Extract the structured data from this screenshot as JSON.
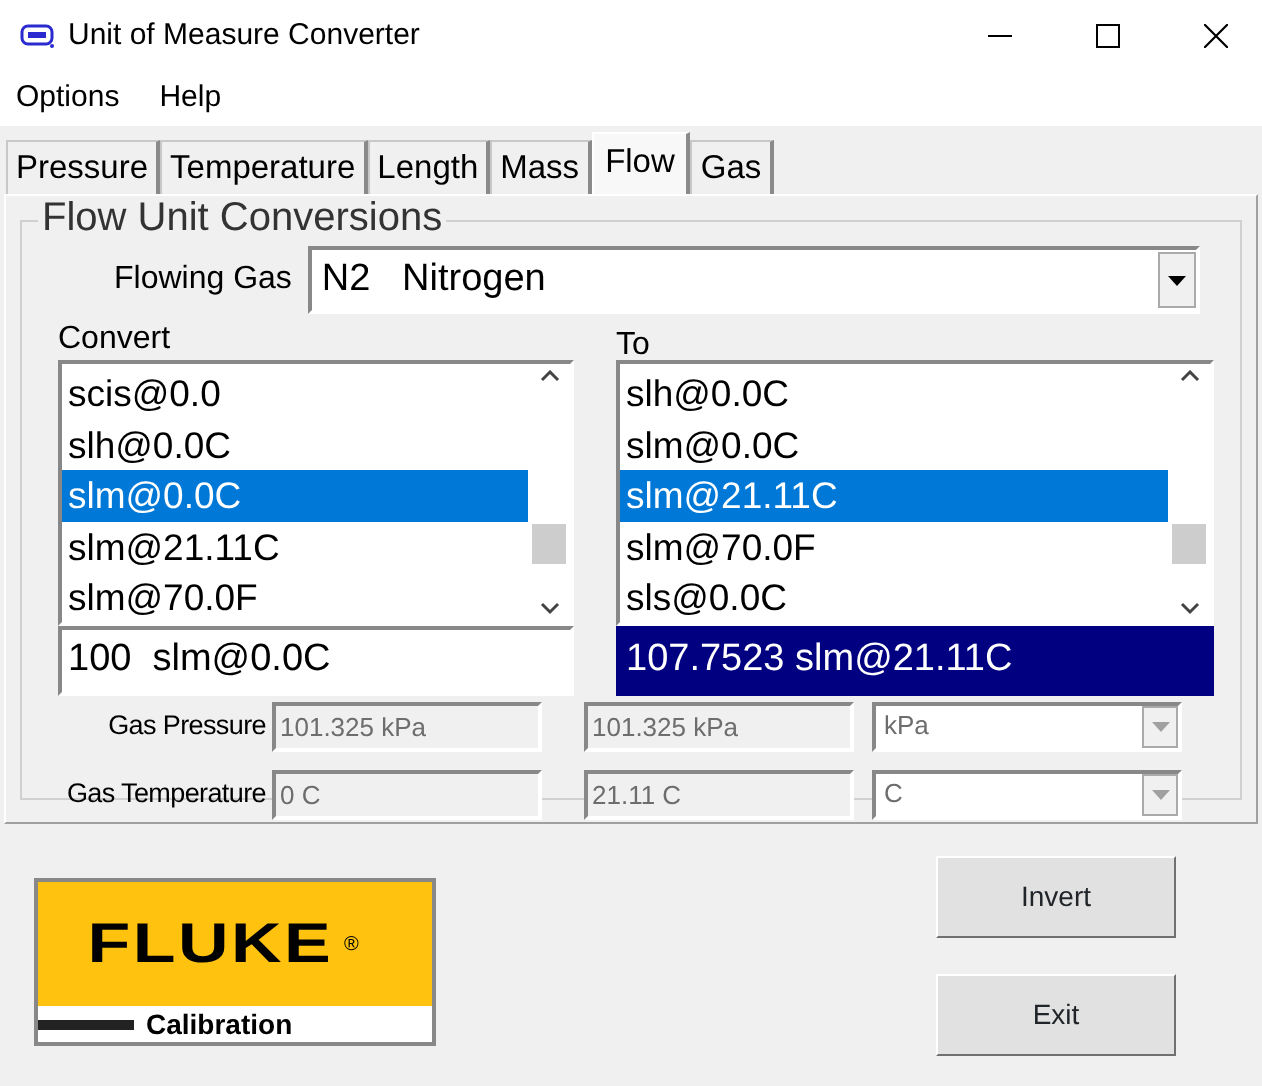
{
  "window": {
    "title": "Unit of Measure Converter"
  },
  "menu": [
    "Options",
    "Help"
  ],
  "tabs": [
    {
      "label": "Pressure",
      "selected": false
    },
    {
      "label": "Temperature",
      "selected": false
    },
    {
      "label": "Length",
      "selected": false
    },
    {
      "label": "Mass",
      "selected": false
    },
    {
      "label": "Flow",
      "selected": true
    },
    {
      "label": "Gas",
      "selected": false
    }
  ],
  "group": {
    "title": "Flow Unit Conversions",
    "flowing_gas": {
      "label": "Flowing Gas",
      "value": "N2   Nitrogen"
    },
    "convert": {
      "label": "Convert",
      "items": [
        {
          "text": "scis@0.0",
          "selected": false
        },
        {
          "text": "slh@0.0C",
          "selected": false
        },
        {
          "text": "slm@0.0C",
          "selected": true
        },
        {
          "text": "slm@21.11C",
          "selected": false
        },
        {
          "text": "slm@70.0F",
          "selected": false
        }
      ],
      "value": "100  slm@0.0C"
    },
    "to": {
      "label": "To",
      "items": [
        {
          "text": "slh@0.0C",
          "selected": false
        },
        {
          "text": "slm@0.0C",
          "selected": false
        },
        {
          "text": "slm@21.11C",
          "selected": true
        },
        {
          "text": "slm@70.0F",
          "selected": false
        },
        {
          "text": "sls@0.0C",
          "selected": false
        }
      ],
      "value": "107.7523 slm@21.11C"
    },
    "conditions": [
      {
        "label": "Gas Pressure",
        "from": "101.325 kPa",
        "to": "101.325 kPa",
        "unit": "kPa",
        "disabled": true
      },
      {
        "label": "Gas Temperature",
        "from": "0 C",
        "to": "21.11 C",
        "unit": "C",
        "disabled": true
      }
    ]
  },
  "logo": {
    "brand": "FLUKE",
    "mark": "®",
    "tagline": "Calibration"
  },
  "buttons": [
    "Invert",
    "Exit"
  ]
}
